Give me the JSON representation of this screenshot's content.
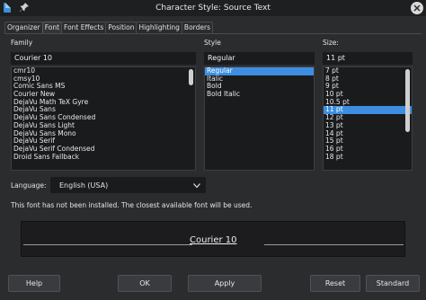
{
  "window": {
    "title": "Character Style: Source Text"
  },
  "tabs": [
    "Organizer",
    "Font",
    "Font Effects",
    "Position",
    "Highlighting",
    "Borders"
  ],
  "family": {
    "label": "Family",
    "value": "Courier 10",
    "items": [
      "cmr10",
      "cmsy10",
      "Comic Sans MS",
      "Courier New",
      "DejaVu Math TeX Gyre",
      "DejaVu Sans",
      "DejaVu Sans Condensed",
      "DejaVu Sans Light",
      "DejaVu Sans Mono",
      "DejaVu Serif",
      "DejaVu Serif Condensed",
      "Droid Sans Fallback"
    ]
  },
  "style": {
    "label": "Style",
    "value": "Regular",
    "items": [
      "Regular",
      "Italic",
      "Bold",
      "Bold Italic"
    ],
    "selected_index": 0
  },
  "size": {
    "label": "Size:",
    "value": "11 pt",
    "items": [
      "7 pt",
      "8 pt",
      "9 pt",
      "10 pt",
      "10.5 pt",
      "11 pt",
      "12 pt",
      "13 pt",
      "14 pt",
      "15 pt",
      "16 pt",
      "18 pt"
    ],
    "selected_index": 5
  },
  "language": {
    "label": "Language:",
    "value": "English (USA)"
  },
  "notice": "This font has not been installed. The closest available font will be used.",
  "preview": {
    "text": "Courier 10"
  },
  "buttons": {
    "help": "Help",
    "ok": "OK",
    "apply": "Apply",
    "reset": "Reset",
    "standard": "Standard"
  },
  "icons": {
    "app": "document-icon",
    "pin": "pin-icon",
    "close": "close-icon",
    "dropdown": "chevron-down-icon"
  },
  "colors": {
    "selection": "#3d8ee0",
    "background": "#2b2c2e"
  }
}
